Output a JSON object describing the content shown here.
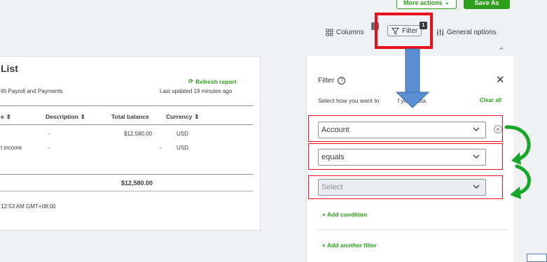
{
  "toolbar": {
    "more_actions_label": "More actions",
    "save_as_label": "Save As",
    "columns_label": "Columns",
    "columns_badge": "",
    "filter_label": "Filter",
    "filter_badge": "1",
    "general_options_label": "General options"
  },
  "report": {
    "title": "List",
    "subtitle": "ith Payroll and Payments",
    "refresh_label": "Refresh report",
    "updated_label": "Last updated 19 minutes ago",
    "columns": [
      "e",
      "Description",
      "Total balance",
      "Currency"
    ],
    "rows": [
      {
        "name": "",
        "description": "-",
        "balance": "$12,580.00",
        "currency": "USD"
      },
      {
        "name": "t income",
        "description": "-",
        "balance": "-",
        "currency": "USD"
      }
    ],
    "total": "$12,580.00",
    "footer": "12:53 AM GMT+08:00"
  },
  "filter_panel": {
    "title": "Filter",
    "description": "Select how you want to",
    "description_end": "f your data.",
    "clear_all_label": "Clear all",
    "field_value": "Account",
    "operator_value": "equals",
    "value_placeholder": "Select",
    "add_condition_label": "+ Add condition",
    "add_filter_label": "+ Add another filter"
  },
  "colors": {
    "brand_green": "#2ca01c",
    "highlight_red": "#e8101b",
    "arrow_blue": "#4a7cbf",
    "annotation_green": "#17a829"
  }
}
